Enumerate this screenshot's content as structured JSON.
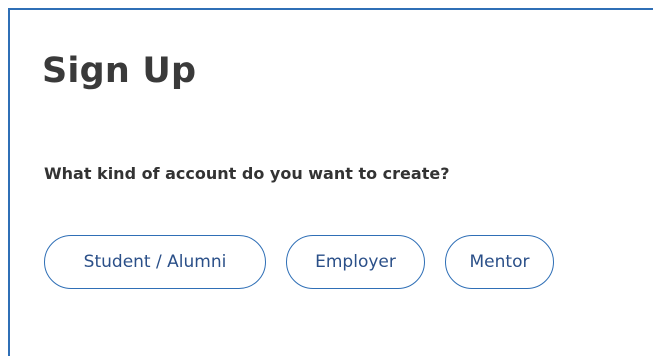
{
  "signup": {
    "title": "Sign Up",
    "question": "What kind of account do you want to create?",
    "options": [
      {
        "label": "Student / Alumni"
      },
      {
        "label": "Employer"
      },
      {
        "label": "Mentor"
      }
    ]
  },
  "colors": {
    "accent": "#2f6fb6",
    "text_dark": "#333333",
    "button_text": "#2a4f88"
  }
}
